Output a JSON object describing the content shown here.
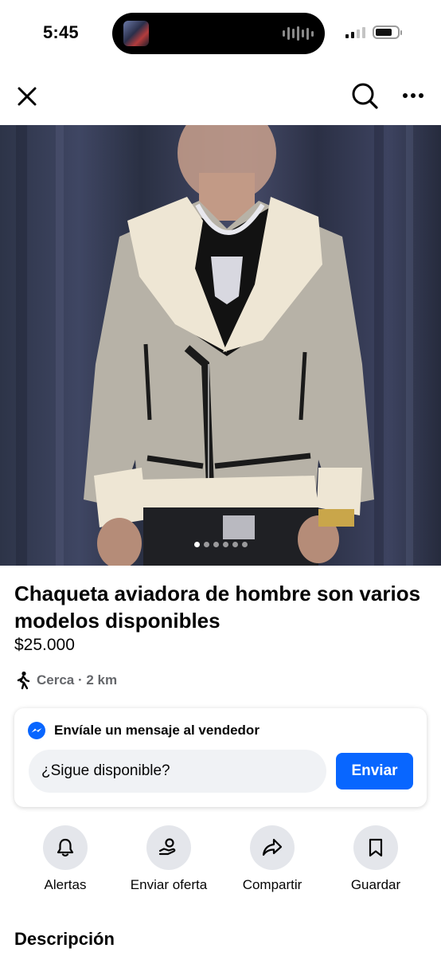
{
  "status_bar": {
    "time": "5:45"
  },
  "nav": {
    "close_icon": "close-icon",
    "search_icon": "search-icon",
    "more_icon": "more-horizontal-icon"
  },
  "gallery": {
    "image_count": 6,
    "active_index": 0
  },
  "product": {
    "title": "Chaqueta aviadora de hombre son varios modelos disponibles",
    "price": "$25.000",
    "location": "Cerca · 2 km"
  },
  "message": {
    "heading": "Envíale un mensaje al vendedor",
    "input_value": "¿Sigue disponible?",
    "send_label": "Enviar"
  },
  "actions": [
    {
      "label": "Alertas",
      "icon": "bell-icon"
    },
    {
      "label": "Enviar oferta",
      "icon": "offer-icon"
    },
    {
      "label": "Compartir",
      "icon": "share-icon"
    },
    {
      "label": "Guardar",
      "icon": "bookmark-icon"
    }
  ],
  "description": {
    "heading": "Descripción"
  },
  "colors": {
    "accent": "#0866ff",
    "text": "#050505",
    "secondary": "#65676b",
    "button_bg": "#e4e6eb"
  }
}
